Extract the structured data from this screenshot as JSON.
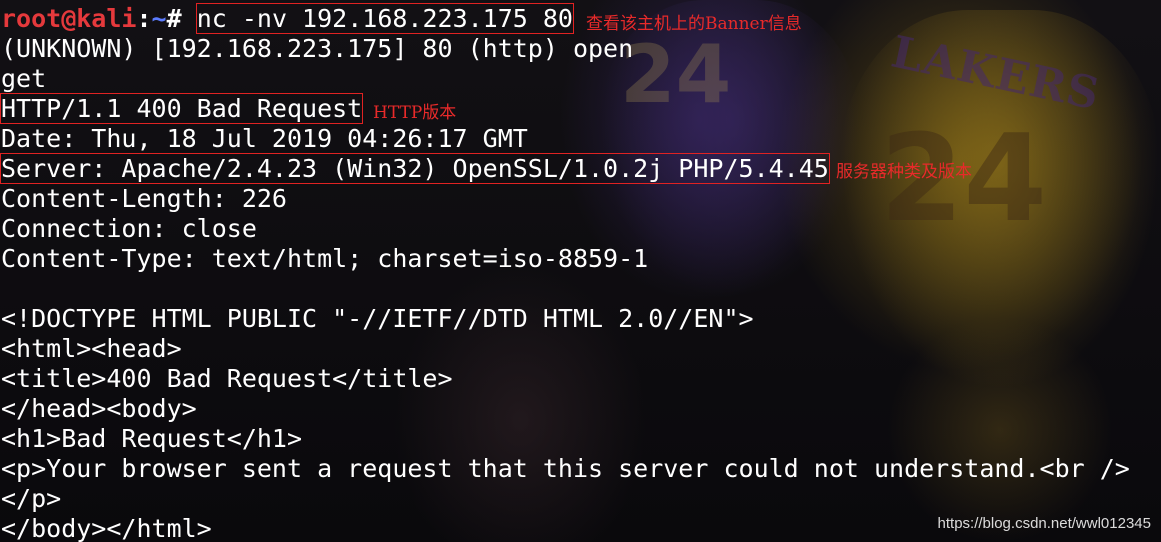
{
  "prompt": {
    "user_host": "root@kali",
    "separator": ":",
    "path": "~",
    "symbol": "# "
  },
  "command": "nc -nv 192.168.223.175 80",
  "output_lines": [
    "(UNKNOWN) [192.168.223.175] 80 (http) open",
    "get",
    "HTTP/1.1 400 Bad Request",
    "Date: Thu, 18 Jul 2019 04:26:17 GMT",
    "Server: Apache/2.4.23 (Win32) OpenSSL/1.0.2j PHP/5.4.45",
    "Content-Length: 226",
    "Connection: close",
    "Content-Type: text/html; charset=iso-8859-1",
    "",
    "<!DOCTYPE HTML PUBLIC \"-//IETF//DTD HTML 2.0//EN\">",
    "<html><head>",
    "<title>400 Bad Request</title>",
    "</head><body>",
    "<h1>Bad Request</h1>",
    "<p>Your browser sent a request that this server could not understand.<br />",
    "</p>",
    "</body></html>"
  ],
  "annotations": {
    "command": "查看该主机上的Banner信息",
    "http_version": "HTTP版本",
    "server": "服务器种类及版本"
  },
  "background": {
    "number_left": "24",
    "number_right": "24",
    "team": "LAKERS"
  },
  "watermark": "https://blog.csdn.net/wwl012345",
  "colors": {
    "prompt_user": "#e5393c",
    "prompt_path": "#5c7cff",
    "annotation": "#e82a2a",
    "box_outline": "#e02222",
    "text": "#ffffff"
  }
}
